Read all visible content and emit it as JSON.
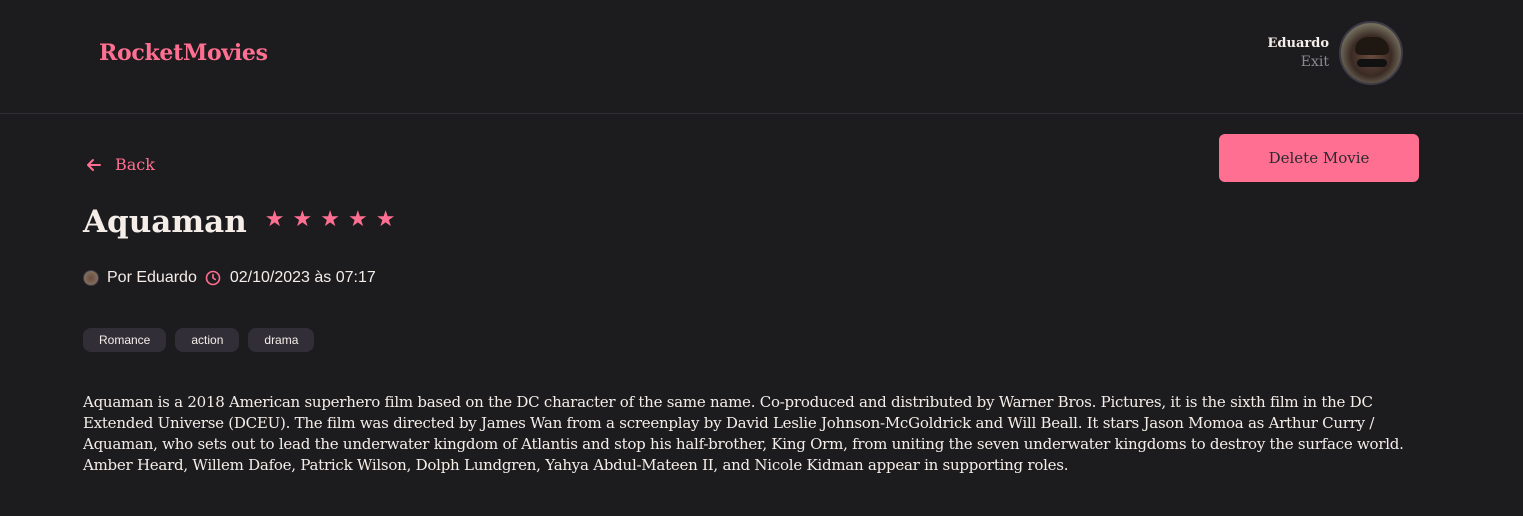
{
  "header": {
    "brand": "RocketMovies",
    "user_name": "Eduardo",
    "exit_label": "Exit"
  },
  "actions": {
    "back_label": "Back",
    "delete_label": "Delete Movie"
  },
  "movie": {
    "title": "Aquaman",
    "rating": 5,
    "stars": [
      "★",
      "★",
      "★",
      "★",
      "★"
    ],
    "author": "Por Eduardo",
    "datetime": "02/10/2023 às 07:17",
    "tags": [
      "Romance",
      "action",
      "drama"
    ],
    "description": "Aquaman is a 2018 American superhero film based on the DC character of the same name. Co-produced and distributed by Warner Bros. Pictures, it is the sixth film in the DC Extended Universe (DCEU). The film was directed by James Wan from a screenplay by David Leslie Johnson-McGoldrick and Will Beall. It stars Jason Momoa as Arthur Curry / Aquaman, who sets out to lead the underwater kingdom of Atlantis and stop his half-brother, King Orm, from uniting the seven underwater kingdoms to destroy the surface world. Amber Heard, Willem Dafoe, Patrick Wilson, Dolph Lundgren, Yahya Abdul-Mateen II, and Nicole Kidman appear in supporting roles."
  },
  "icons": {
    "back": "arrow-left-icon",
    "clock": "clock-icon",
    "star": "star-icon"
  },
  "colors": {
    "background": "#1c1b1e",
    "accent": "#ff6f91",
    "text": "#f4ede8",
    "muted": "#8c8a90",
    "tag_bg": "#312e38"
  }
}
